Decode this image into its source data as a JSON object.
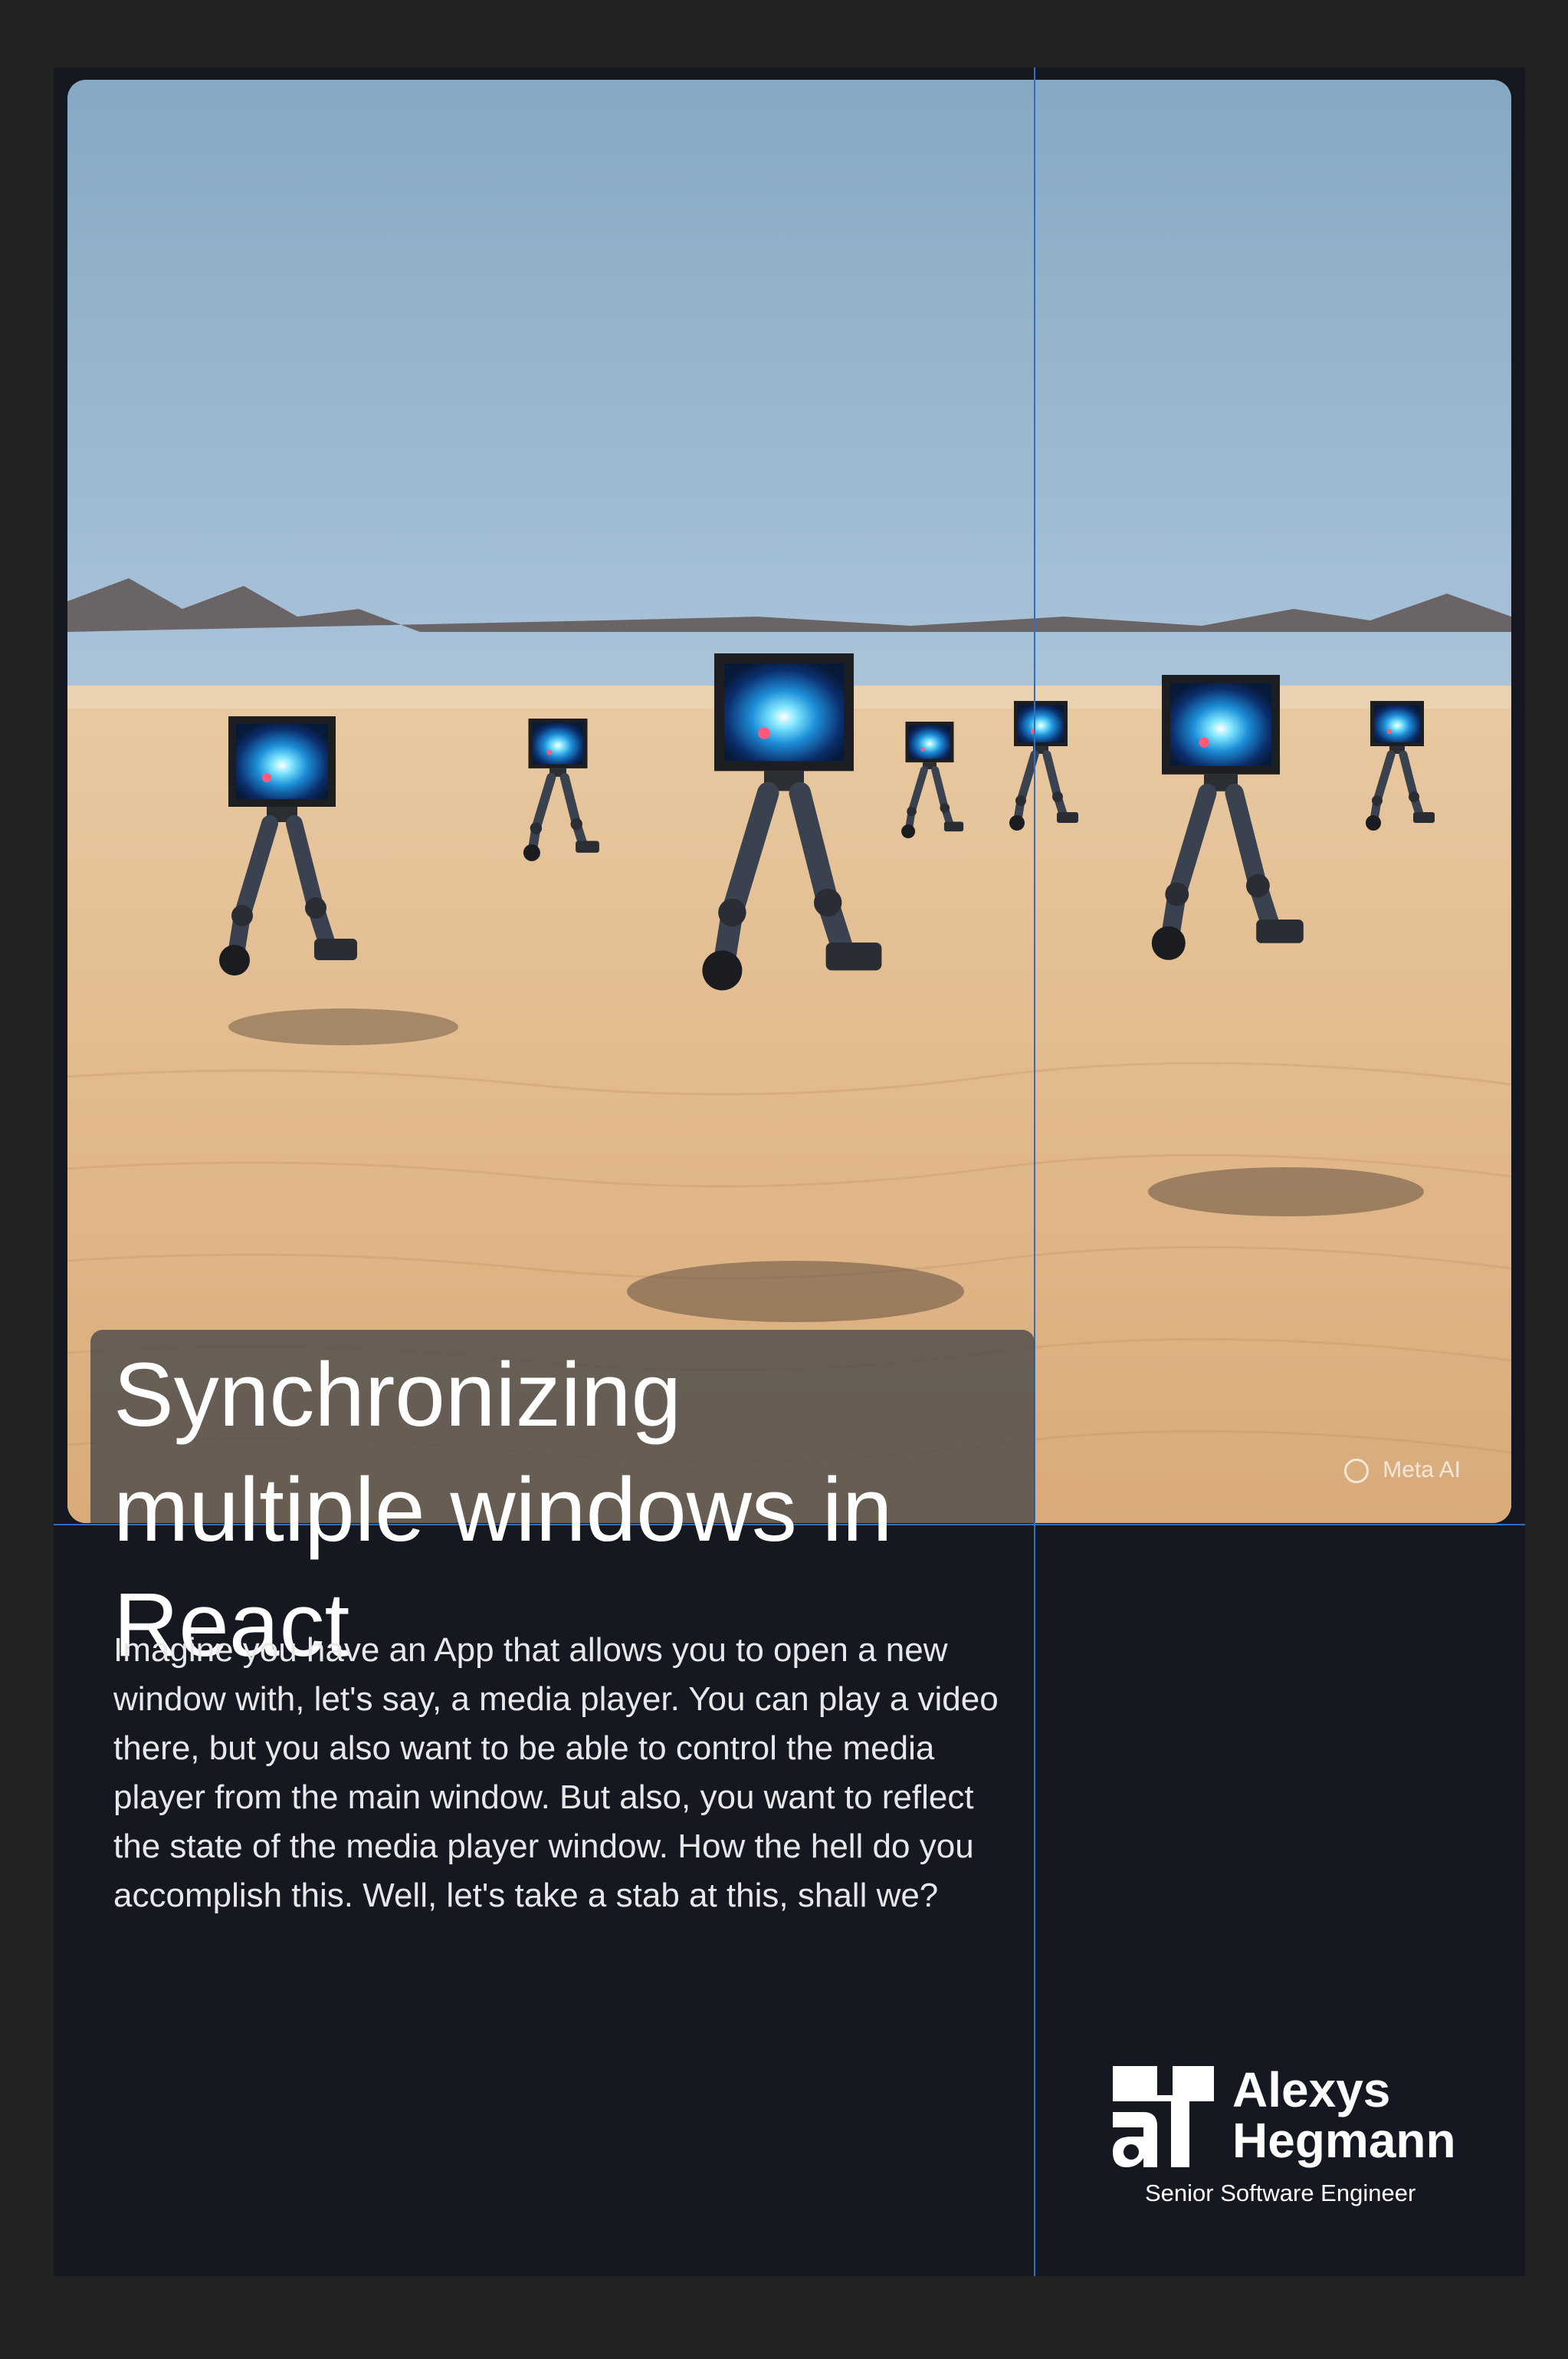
{
  "hero": {
    "watermark": "Meta AI",
    "image_alt": "Robots with screen heads walking in a desert"
  },
  "article": {
    "title": "Synchronizing multiple windows in React",
    "description": "Imagine you have an App that allows you to open a new window with, let's say, a media player. You can play a video there, but you also want to be able to control the media player from the main window. But also, you want to reflect the state of the media player window. How the hell do you accomplish this. Well, let's take a stab at this, shall we?"
  },
  "author": {
    "first_name": "Alexys",
    "last_name": "Hegmann",
    "role": "Senior Software Engineer",
    "logo_icon": "ah-logo-icon"
  },
  "colors": {
    "page_bg": "#222222",
    "card_bg": "#151820",
    "guide_line": "#2f6fbf",
    "title_box": "#464648"
  }
}
